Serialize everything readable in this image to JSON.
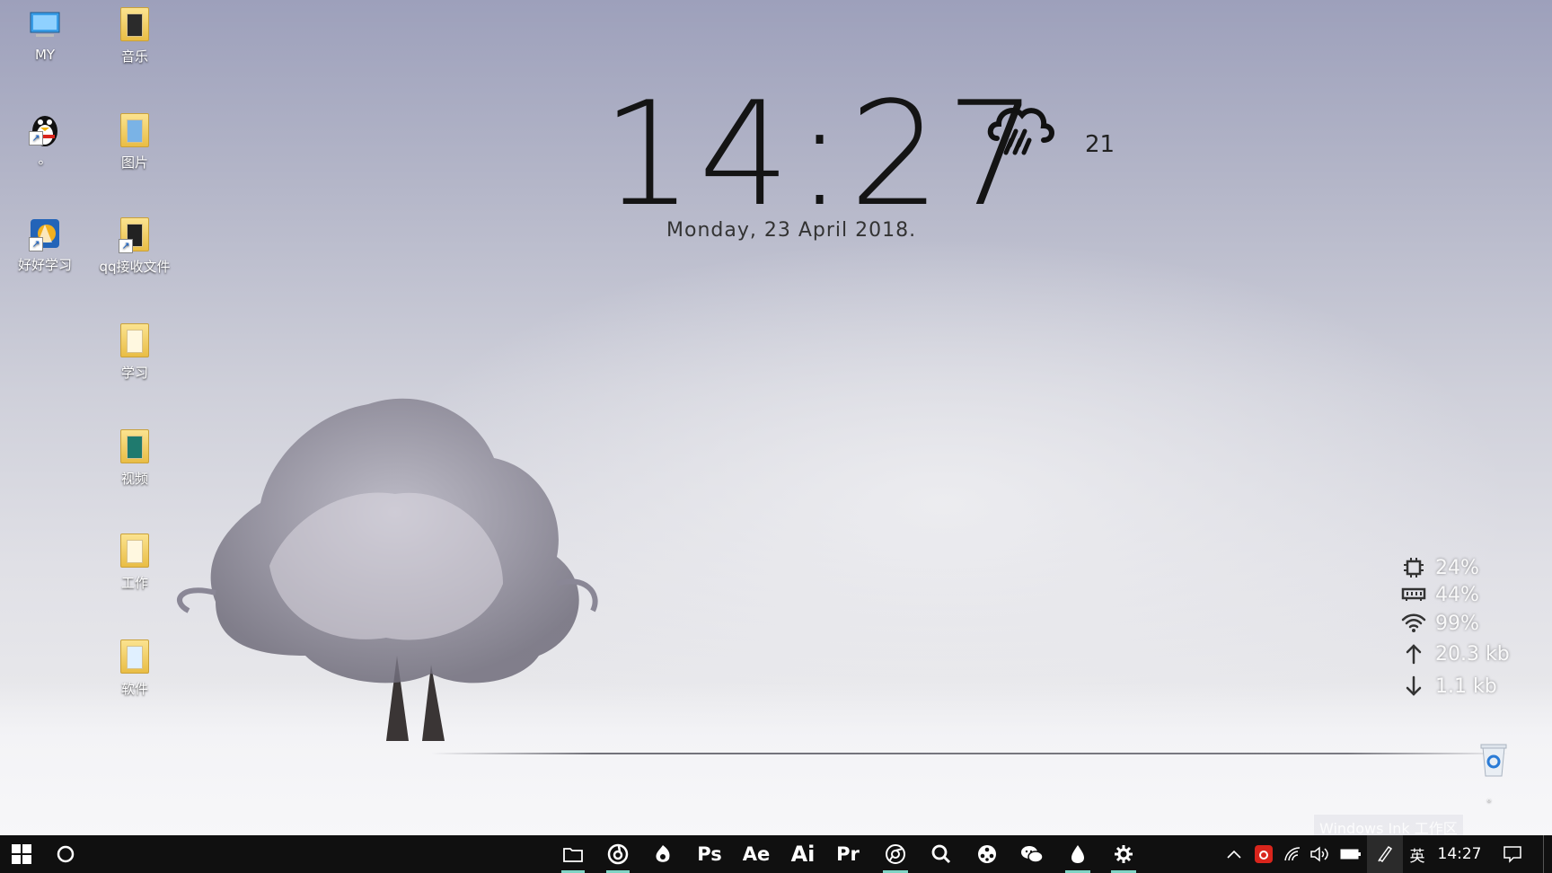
{
  "desktop": {
    "icons": [
      {
        "label": "MY"
      },
      {
        "label": "音乐"
      },
      {
        "label": "。"
      },
      {
        "label": "图片"
      },
      {
        "label": "好好学习"
      },
      {
        "label": "qq接收文件"
      },
      {
        "label": "学习"
      },
      {
        "label": "视频"
      },
      {
        "label": "工作"
      },
      {
        "label": "软件"
      }
    ],
    "recycle_bin_label": "。"
  },
  "widget": {
    "time": "14:27",
    "date": "Monday, 23 April 2018.",
    "temperature": "21",
    "weather_icon": "rain-cloud-icon"
  },
  "stats": {
    "cpu": "24%",
    "ram": "44%",
    "wifi": "99%",
    "upload": "20.3 kb",
    "download": "1.1 kb"
  },
  "watermark": "Windows Ink 工作区",
  "taskbar": {
    "apps": [
      {
        "name": "file-explorer-icon"
      },
      {
        "name": "netease-music-icon"
      },
      {
        "name": "qq-browser-icon"
      },
      {
        "label": "Ps"
      },
      {
        "label": "Ae"
      },
      {
        "label": "Ai"
      },
      {
        "label": "Pr"
      },
      {
        "name": "chrome-icon"
      },
      {
        "name": "search-app-icon"
      },
      {
        "name": "video-player-icon"
      },
      {
        "name": "wechat-icon"
      },
      {
        "name": "water-drop-icon"
      },
      {
        "name": "settings-icon"
      }
    ],
    "tray": {
      "ime": "英",
      "clock": "14:27"
    },
    "accent_color": "#7fd4c4"
  }
}
